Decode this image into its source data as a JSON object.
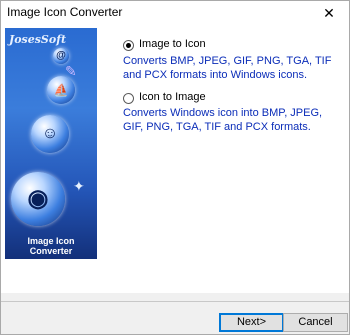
{
  "window": {
    "title": "Image Icon Converter",
    "close_glyph": "✕"
  },
  "banner": {
    "brand": "JosesSoft",
    "footer": "Image Icon Converter"
  },
  "options": [
    {
      "label": "Image to Icon",
      "selected": true,
      "description": "Converts BMP, JPEG, GIF, PNG, TGA, TIF and PCX formats into Windows icons."
    },
    {
      "label": "Icon to Image",
      "selected": false,
      "description": "Converts Windows icon into BMP, JPEG, GIF, PNG, TGA, TIF and PCX formats."
    }
  ],
  "buttons": {
    "next": "Next>",
    "cancel": "Cancel"
  },
  "colors": {
    "description_text": "#0b2db8",
    "banner_blue": "#2a6bd1"
  }
}
